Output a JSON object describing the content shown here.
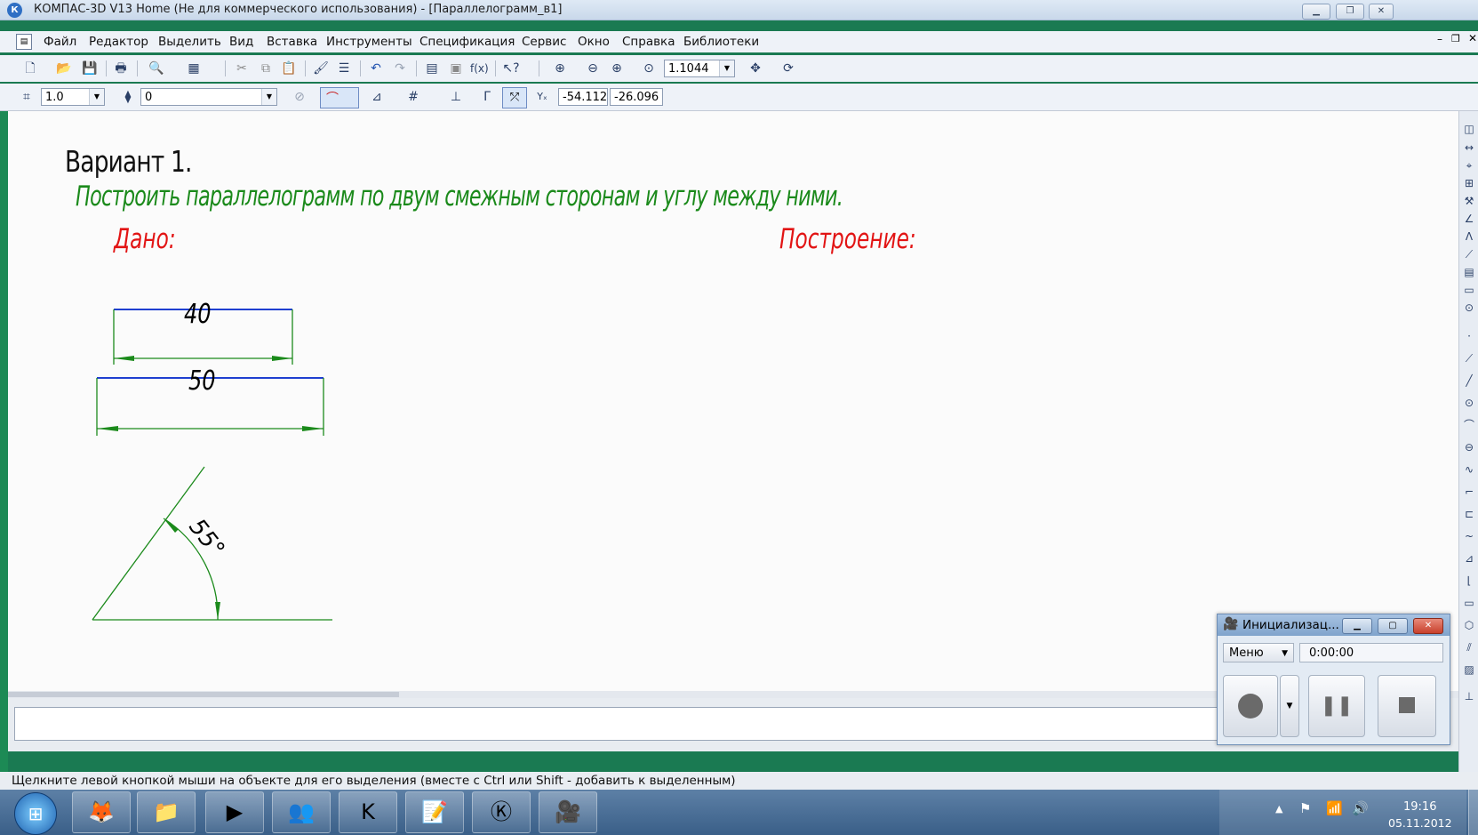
{
  "window": {
    "title": "КОМПАС-3D V13 Home (Не для коммерческого использования) - [Параллелограмм_в1]",
    "app_icon": "kompas-logo-icon",
    "controls": [
      "minimize",
      "restore",
      "close"
    ]
  },
  "menu": [
    "Файл",
    "Редактор",
    "Выделить",
    "Вид",
    "Вставка",
    "Инструменты",
    "Спецификация",
    "Сервис",
    "Окно",
    "Справка",
    "Библиотеки"
  ],
  "toolbar1": {
    "zoom_value": "1.1044"
  },
  "toolbar2": {
    "step_value": "1.0",
    "layer_value": "0",
    "coord_x": "-54.112",
    "coord_y": "-26.096"
  },
  "drawing": {
    "variant_title": "Вариант 1.",
    "task_text": "Построить параллелограмм по двум смежным сторонам и углу между ними.",
    "given_label": "Дано:",
    "construction_label": "Построение:",
    "dim_side_a": "40",
    "dim_side_b": "50",
    "dim_angle": "55°",
    "colors": {
      "green": "#1b8a1b",
      "red": "#e21414",
      "blue": "#1f3fd0"
    }
  },
  "statusbar": {
    "hint": "Щелкните левой кнопкой мыши на объекте для его выделения (вместе с Ctrl или Shift - добавить к выделенным)"
  },
  "recorder": {
    "title": "Инициализац...",
    "menu_label": "Меню",
    "time": "0:00:00"
  },
  "taskbar": {
    "items": [
      "start-orb-icon",
      "firefox-icon",
      "explorer-icon",
      "media-player-icon",
      "users-icon",
      "kaspersky-icon",
      "notepad-icon",
      "kompas-icon",
      "camtasia-icon"
    ],
    "clock_time": "19:16",
    "clock_date": "05.11.2012"
  }
}
